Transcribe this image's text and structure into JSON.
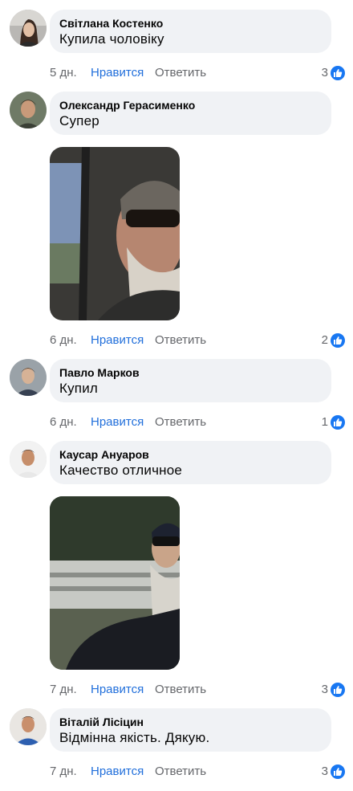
{
  "comments": [
    {
      "author": "Світлана Костенко",
      "text": "Купила чоловіку",
      "time": "5 дн.",
      "like_label": "Нравится",
      "reply_label": "Ответить",
      "reactions": "3"
    },
    {
      "author": "Олександр Герасименко",
      "text": "Супер",
      "time": "6 дн.",
      "like_label": "Нравится",
      "reply_label": "Ответить",
      "reactions": "2"
    },
    {
      "author": "Павло Марков",
      "text": "Купил",
      "time": "6 дн.",
      "like_label": "Нравится",
      "reply_label": "Ответить",
      "reactions": "1"
    },
    {
      "author": "Каусар Ануаров",
      "text": "Качество отличное",
      "time": "7 дн.",
      "like_label": "Нравится",
      "reply_label": "Ответить",
      "reactions": "3"
    },
    {
      "author": "Віталій Лісіцин",
      "text": "Відмінна якість. Дякую.",
      "time": "7 дн.",
      "like_label": "Нравится",
      "reply_label": "Ответить",
      "reactions": "3"
    }
  ],
  "colors": {
    "bubble": "#f0f2f5",
    "like_link": "#216fdb",
    "meta_text": "#65676b",
    "like_badge": "#1877f2"
  },
  "icons": {
    "reaction": "thumbs-up-icon",
    "avatar": "user-avatar",
    "attachment": "photo-attachment"
  }
}
